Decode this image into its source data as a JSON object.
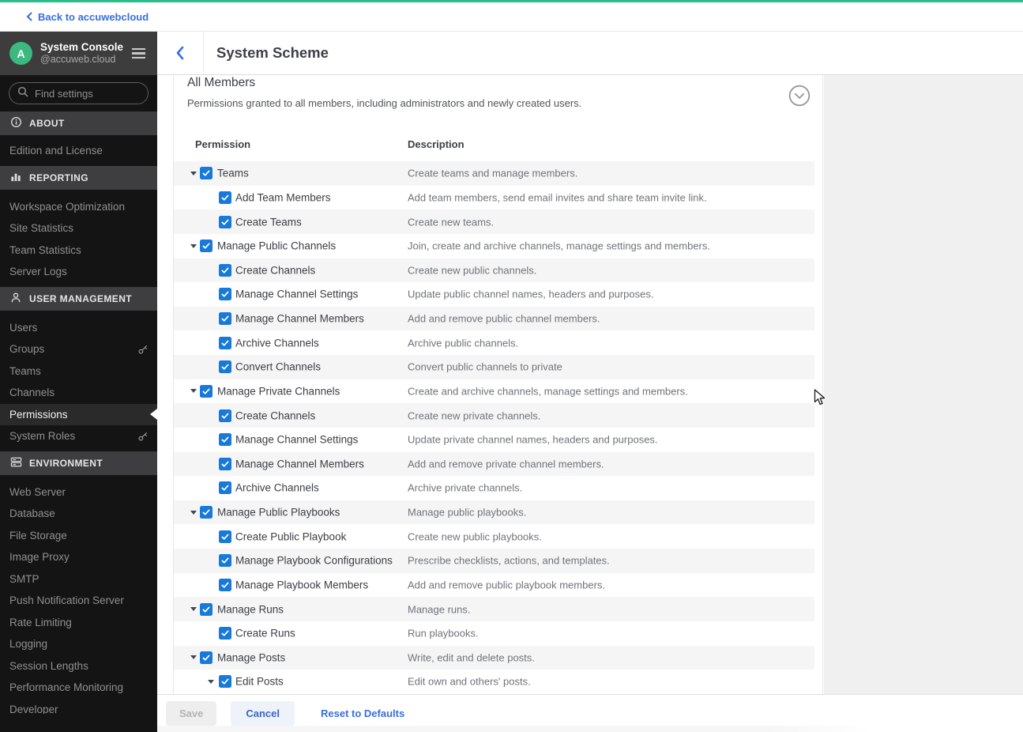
{
  "colors": {
    "accent_green": "#28bd8b",
    "link_blue": "#386fde",
    "checkbox_blue": "#1779d9",
    "avatar_green": "#3db87e",
    "stripe_gray": "#f5f5f5",
    "sidebar_bg": "#141414",
    "sidebar_header_bg": "#3d3d3d",
    "section_header_bg": "#3e3e40",
    "right_panel_gray": "#f0f0f0"
  },
  "topbar": {
    "back_label": "Back to accuwebcloud"
  },
  "sidebar": {
    "title": "System Console",
    "subtitle": "@accuweb.cloud",
    "avatar_letter": "A",
    "search_placeholder": "Find settings",
    "sections": [
      {
        "label": "ABOUT",
        "icon": "info-icon",
        "items": [
          {
            "label": "Edition and License"
          }
        ]
      },
      {
        "label": "REPORTING",
        "icon": "chart-icon",
        "items": [
          {
            "label": "Workspace Optimization"
          },
          {
            "label": "Site Statistics"
          },
          {
            "label": "Team Statistics"
          },
          {
            "label": "Server Logs"
          }
        ]
      },
      {
        "label": "USER MANAGEMENT",
        "icon": "users-icon",
        "items": [
          {
            "label": "Users"
          },
          {
            "label": "Groups",
            "key": true
          },
          {
            "label": "Teams"
          },
          {
            "label": "Channels"
          },
          {
            "label": "Permissions",
            "selected": true
          },
          {
            "label": "System Roles",
            "key": true
          }
        ]
      },
      {
        "label": "ENVIRONMENT",
        "icon": "server-icon",
        "items": [
          {
            "label": "Web Server"
          },
          {
            "label": "Database"
          },
          {
            "label": "File Storage"
          },
          {
            "label": "Image Proxy"
          },
          {
            "label": "SMTP"
          },
          {
            "label": "Push Notification Server"
          },
          {
            "label": "Rate Limiting"
          },
          {
            "label": "Logging"
          },
          {
            "label": "Session Lengths"
          },
          {
            "label": "Performance Monitoring"
          },
          {
            "label": "Developer"
          }
        ]
      }
    ]
  },
  "header": {
    "title": "System Scheme"
  },
  "scheme": {
    "title": "All Members",
    "description": "Permissions granted to all members, including administrators and newly created users.",
    "columns": [
      "Permission",
      "Description"
    ],
    "rows": [
      {
        "label": "Teams",
        "desc": "Create teams and manage members.",
        "level": "parent",
        "checked": true
      },
      {
        "label": "Add Team Members",
        "desc": "Add team members, send email invites and share team invite link.",
        "level": "child",
        "checked": true
      },
      {
        "label": "Create Teams",
        "desc": "Create new teams.",
        "level": "child",
        "checked": true
      },
      {
        "label": "Manage Public Channels",
        "desc": "Join, create and archive channels, manage settings and members.",
        "level": "parent",
        "checked": true
      },
      {
        "label": "Create Channels",
        "desc": "Create new public channels.",
        "level": "child",
        "checked": true
      },
      {
        "label": "Manage Channel Settings",
        "desc": "Update public channel names, headers and purposes.",
        "level": "child",
        "checked": true
      },
      {
        "label": "Manage Channel Members",
        "desc": "Add and remove public channel members.",
        "level": "child",
        "checked": true
      },
      {
        "label": "Archive Channels",
        "desc": "Archive public channels.",
        "level": "child",
        "checked": true
      },
      {
        "label": "Convert Channels",
        "desc": "Convert public channels to private",
        "level": "child",
        "checked": true
      },
      {
        "label": "Manage Private Channels",
        "desc": "Create and archive channels, manage settings and members.",
        "level": "parent",
        "checked": true
      },
      {
        "label": "Create Channels",
        "desc": "Create new private channels.",
        "level": "child",
        "checked": true
      },
      {
        "label": "Manage Channel Settings",
        "desc": "Update private channel names, headers and purposes.",
        "level": "child",
        "checked": true
      },
      {
        "label": "Manage Channel Members",
        "desc": "Add and remove private channel members.",
        "level": "child",
        "checked": true
      },
      {
        "label": "Archive Channels",
        "desc": "Archive private channels.",
        "level": "child",
        "checked": true
      },
      {
        "label": "Manage Public Playbooks",
        "desc": "Manage public playbooks.",
        "level": "parent",
        "checked": true
      },
      {
        "label": "Create Public Playbook",
        "desc": "Create new public playbooks.",
        "level": "child",
        "checked": true
      },
      {
        "label": "Manage Playbook Configurations",
        "desc": "Prescribe checklists, actions, and templates.",
        "level": "child",
        "checked": true
      },
      {
        "label": "Manage Playbook Members",
        "desc": "Add and remove public playbook members.",
        "level": "child",
        "checked": true
      },
      {
        "label": "Manage Runs",
        "desc": "Manage runs.",
        "level": "parent",
        "checked": true
      },
      {
        "label": "Create Runs",
        "desc": "Run playbooks.",
        "level": "child",
        "checked": true
      },
      {
        "label": "Manage Posts",
        "desc": "Write, edit and delete posts.",
        "level": "parent",
        "checked": true
      },
      {
        "label": "Edit Posts",
        "desc": "Edit own and others' posts.",
        "level": "childcaret",
        "checked": true
      }
    ]
  },
  "footer": {
    "save_label": "Save",
    "cancel_label": "Cancel",
    "reset_label": "Reset to Defaults"
  }
}
